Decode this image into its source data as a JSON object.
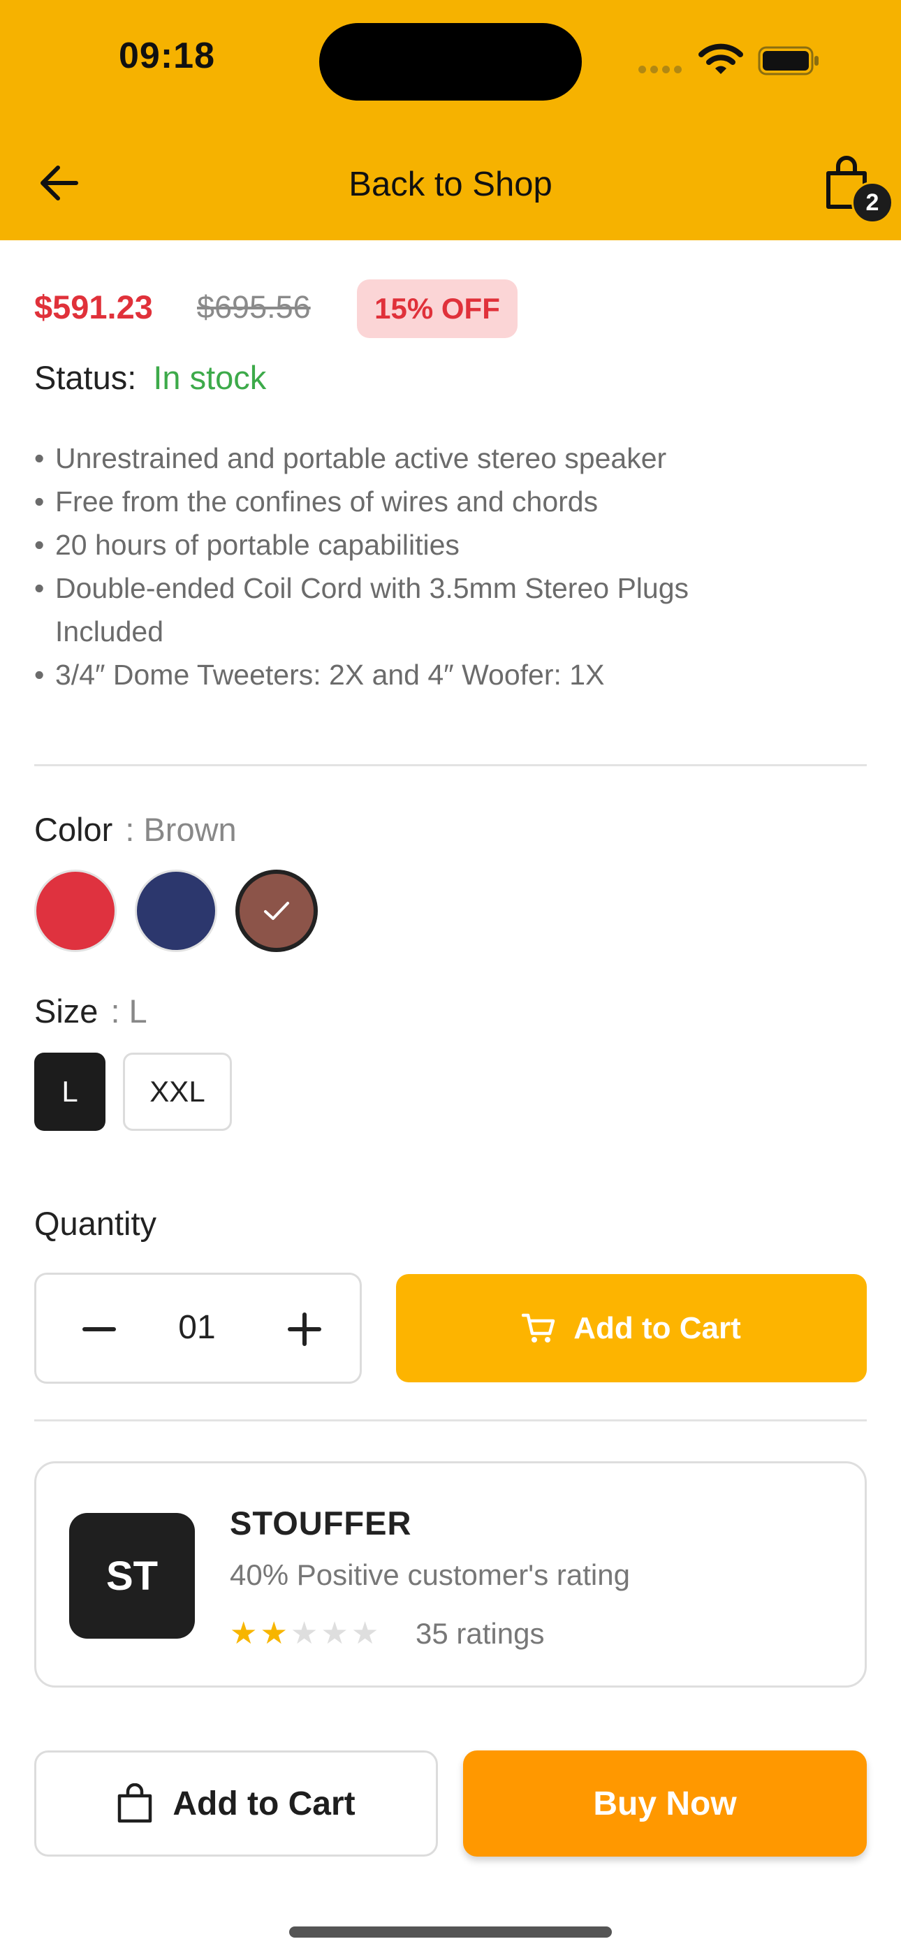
{
  "status_bar": {
    "time": "09:18"
  },
  "header": {
    "title": "Back to Shop",
    "cart_count": "2",
    "accent": "#F6B200"
  },
  "pricing": {
    "price": "$591.23",
    "original_price": "$695.56",
    "discount": "15% OFF"
  },
  "stock": {
    "label": "Status:",
    "value": "In stock"
  },
  "features": [
    "Unrestrained and portable active stereo speaker",
    "Free from the confines of wires and chords",
    "20 hours of portable capabilities",
    "Double-ended Coil Cord with 3.5mm Stereo Plugs Included",
    "3/4″ Dome Tweeters: 2X and 4″ Woofer: 1X"
  ],
  "color": {
    "label": "Color",
    "selected": ": Brown",
    "options": [
      {
        "name": "red",
        "hex": "#DF323F"
      },
      {
        "name": "navy",
        "hex": "#2C376D"
      },
      {
        "name": "brown",
        "hex": "#8C5449"
      }
    ]
  },
  "size": {
    "label": "Size",
    "selected": ": L",
    "options": [
      "L",
      "XXL"
    ]
  },
  "quantity": {
    "label": "Quantity",
    "value": "01",
    "add_to_cart": "Add to Cart"
  },
  "seller": {
    "initials": "ST",
    "name": "STOUFFER",
    "rating_text": "40% Positive customer's rating",
    "stars": 2,
    "stars_max": 5,
    "ratings_count": "35 ratings"
  },
  "actions": {
    "add_to_cart": "Add to Cart",
    "buy_now": "Buy Now"
  },
  "icons": [
    "back-arrow-icon",
    "shopping-bag-icon",
    "wifi-icon",
    "battery-icon",
    "check-icon",
    "minus-icon",
    "plus-icon",
    "cart-icon",
    "star-icon"
  ]
}
